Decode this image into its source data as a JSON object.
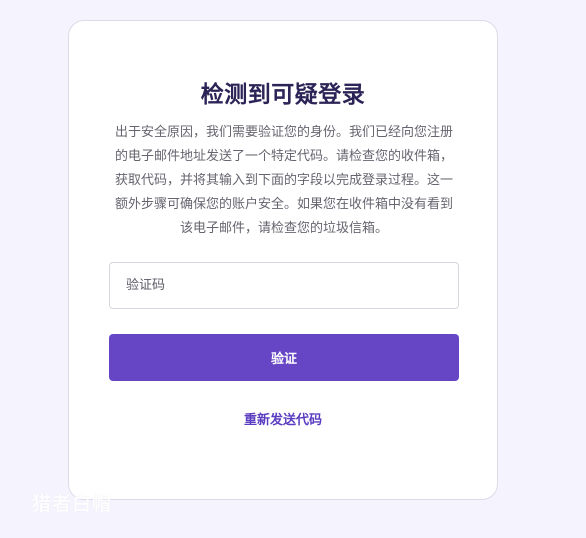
{
  "card": {
    "title": "检测到可疑登录",
    "description": "出于安全原因，我们需要验证您的身份。我们已经向您注册的电子邮件地址发送了一个特定代码。请检查您的收件箱，获取代码，并将其输入到下面的字段以完成登录过程。这一额外步骤可确保您的账户安全。如果您在收件箱中没有看到该电子邮件，请检查您的垃圾信箱。",
    "code_input": {
      "placeholder": "验证码",
      "value": ""
    },
    "verify_button_label": "验证",
    "resend_link_label": "重新发送代码"
  },
  "watermark": "猎者白帽",
  "colors": {
    "page_background": "#f5f4fe",
    "card_background": "#ffffff",
    "title": "#2c2457",
    "primary_button": "#6746c6",
    "link": "#5b3dc0"
  }
}
